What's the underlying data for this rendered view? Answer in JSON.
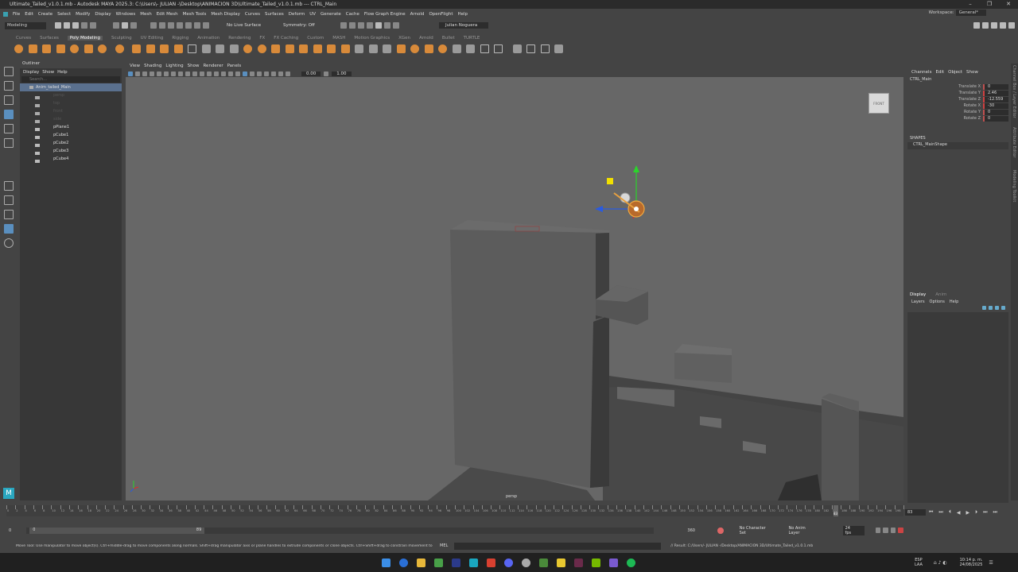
{
  "title_bar": {
    "title": "Ultimate_Tailed_v1.0.1.mb - Autodesk MAYA 2025.3: C:\\Users\\- JULIAN -\\Desktop\\ANIMACION 3D\\Ultimate_Tailed_v1.0.1.mb  ---  CTRL_Main"
  },
  "menu": {
    "items": [
      "File",
      "Edit",
      "Create",
      "Select",
      "Modify",
      "Display",
      "Windows",
      "Mesh",
      "Edit Mesh",
      "Mesh Tools",
      "Mesh Display",
      "Curves",
      "Surfaces",
      "Deform",
      "UV",
      "Generate",
      "Cache",
      "Flow Graph Engine",
      "Arnold",
      "OpenFlight",
      "Help"
    ],
    "workspace_label": "Workspace:",
    "workspace_value": "General*"
  },
  "status_line": {
    "mode": "Modeling",
    "live_surface": "No Live Surface",
    "symmetry": "Symmetry: Off",
    "user": "Julian Noguera"
  },
  "shelf": {
    "tabs": [
      "Curves",
      "Surfaces",
      "Poly Modeling",
      "Sculpting",
      "UV Editing",
      "Rigging",
      "Animation",
      "Rendering",
      "FX",
      "FX Caching",
      "Custom",
      "MASH",
      "Motion Graphics",
      "XGen",
      "Arnold",
      "Bullet",
      "TURTLE"
    ],
    "active_tab": "Poly Modeling"
  },
  "outliner": {
    "title": "Outliner",
    "menu": [
      "Display",
      "Show",
      "Help"
    ],
    "search_placeholder": "Search...",
    "items": [
      {
        "label": "Anim_tailed_Main",
        "state": "selected"
      },
      {
        "label": "persp",
        "state": "dim"
      },
      {
        "label": "top",
        "state": "dim"
      },
      {
        "label": "front",
        "state": "dim"
      },
      {
        "label": "side",
        "state": "dim"
      },
      {
        "label": "pPlane1",
        "state": "mesh"
      },
      {
        "label": "pCube1",
        "state": "mesh"
      },
      {
        "label": "pCube2",
        "state": "mesh"
      },
      {
        "label": "pCube3",
        "state": "mesh"
      },
      {
        "label": "pCube4",
        "state": "mesh"
      }
    ]
  },
  "viewport": {
    "menu": [
      "View",
      "Shading",
      "Lighting",
      "Show",
      "Renderer",
      "Panels"
    ],
    "field_a": "0.00",
    "field_b": "1.00",
    "camera_label": "persp",
    "viewcube_label": "FRONT"
  },
  "channel_box": {
    "menu": [
      "Channels",
      "Edit",
      "Object",
      "Show"
    ],
    "node": "CTRL_Main",
    "attributes": [
      {
        "name": "Translate X",
        "value": "0"
      },
      {
        "name": "Translate Y",
        "value": "2.46"
      },
      {
        "name": "Translate Z",
        "value": "-12.559"
      },
      {
        "name": "Rotate X",
        "value": "-30"
      },
      {
        "name": "Rotate Y",
        "value": "0"
      },
      {
        "name": "Rotate Z",
        "value": "0"
      }
    ],
    "shapes_label": "SHAPES",
    "shape_node": "CTRL_MainShape",
    "layer_tabs": [
      "Display",
      "Anim"
    ],
    "layer_menu": [
      "Layers",
      "Options",
      "Help"
    ],
    "side_tabs": [
      "Channel Box / Layer Editor",
      "Attribute Editor",
      "Modeling Toolkit"
    ]
  },
  "timeline": {
    "ticks": [
      "0",
      "2",
      "4",
      "6",
      "8",
      "10",
      "12",
      "14",
      "16",
      "18",
      "20",
      "22",
      "24",
      "26",
      "28",
      "30",
      "32",
      "34",
      "36",
      "38",
      "40",
      "42",
      "44",
      "46",
      "48",
      "50",
      "52",
      "54",
      "56",
      "58",
      "60",
      "62",
      "64",
      "66",
      "68",
      "70",
      "72",
      "74",
      "76",
      "78",
      "80",
      "82",
      "84",
      "86",
      "88",
      "90",
      "92",
      "94",
      "96",
      "98",
      "100",
      "102",
      "104",
      "106",
      "108",
      "110",
      "112",
      "114",
      "116",
      "118",
      "120",
      "122",
      "124",
      "126",
      "128",
      "130",
      "132",
      "134",
      "136",
      "138",
      "140",
      "142",
      "144",
      "146",
      "148",
      "150",
      "152",
      "154",
      "156",
      "158",
      "160",
      "162",
      "164",
      "166",
      "168",
      "170",
      "172",
      "174",
      "176",
      "178",
      "180",
      "182",
      "184",
      "186",
      "188",
      "190",
      "192",
      "194",
      "196",
      "198",
      "200"
    ],
    "current_frame": "83",
    "current_frame_field": "83",
    "range_start": "0",
    "range_inner_start": "0",
    "range_inner_end": "89",
    "range_end": "360",
    "character_set": "No Character Set",
    "anim_layer": "No Anim Layer",
    "fps": "24 fps"
  },
  "status_bar": {
    "help": "Move Tool: Use manipulator to move object(s). Ctrl+middle-drag to move components along normals. Shift+drag manipulator axis or plane handles to extrude components or clone objects. Ctrl+Shift+drag to constrain movement to a cor",
    "lang": "MEL",
    "result": "// Result: C:/Users/- JULIAN -/Desktop/ANIMACION 3D/Ultimate_Tailed_v1.0.1.mb"
  },
  "taskbar": {
    "lang1": "ESP",
    "lang2": "LAA",
    "time": "10:14 p. m.",
    "date": "24/08/2025"
  },
  "colors": {
    "viewport_bg": "#676767",
    "panel_bg": "#444444",
    "selection": "#5a708e",
    "accent_orange": "#d88a3a",
    "keyframe_red": "#c03030"
  }
}
